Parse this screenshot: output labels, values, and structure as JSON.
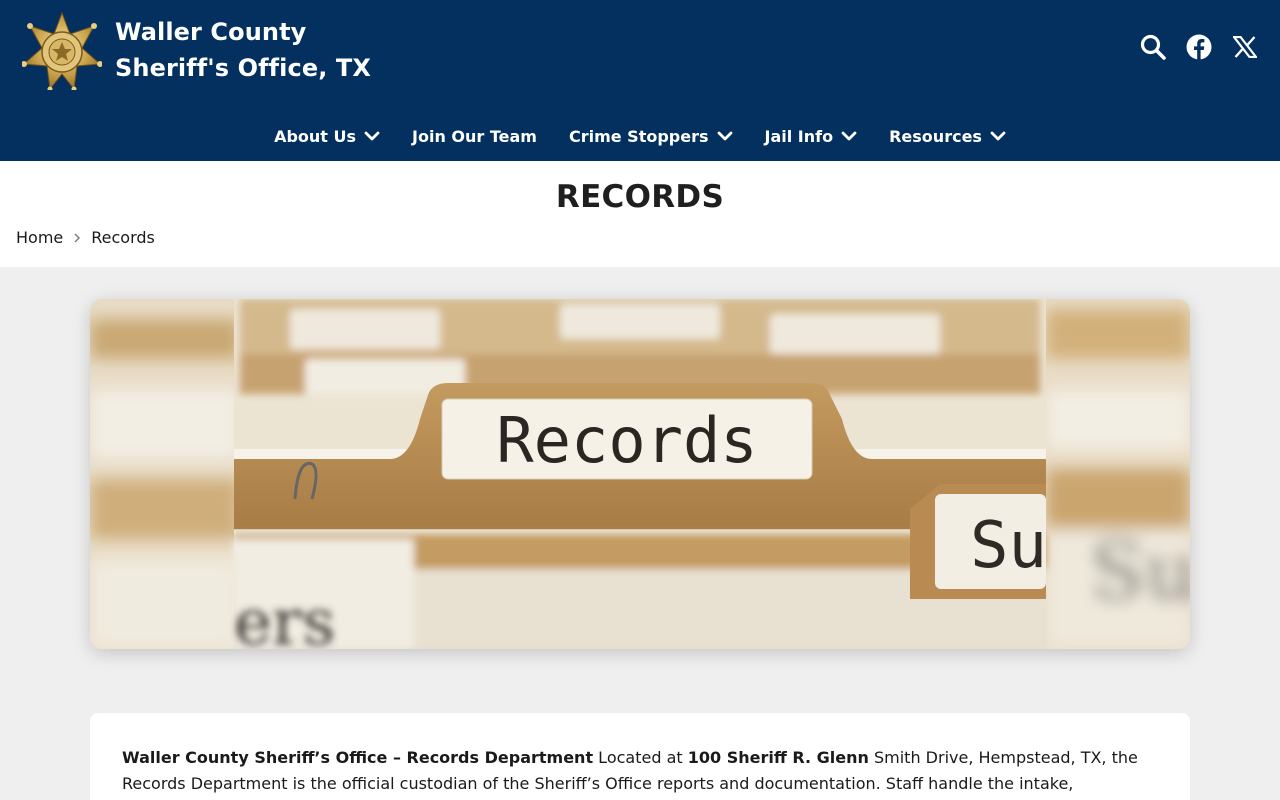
{
  "site": {
    "name_line1": "Waller County",
    "name_line2": "Sheriff's Office, TX",
    "badge_icon": "sheriff-star-badge-icon"
  },
  "header_icons": [
    {
      "name": "search-icon"
    },
    {
      "name": "facebook-icon"
    },
    {
      "name": "x-twitter-icon"
    }
  ],
  "nav": {
    "items": [
      {
        "label": "About Us",
        "has_dropdown": true
      },
      {
        "label": "Join Our Team",
        "has_dropdown": false
      },
      {
        "label": "Crime Stoppers",
        "has_dropdown": true
      },
      {
        "label": "Jail Info",
        "has_dropdown": true
      },
      {
        "label": "Resources",
        "has_dropdown": true
      }
    ]
  },
  "page": {
    "title": "RECORDS",
    "breadcrumb": {
      "home": "Home",
      "current": "Records"
    }
  },
  "hero": {
    "tab_text": "Records",
    "tab_text_right": "Su",
    "tab_text_bottom_left": "ers"
  },
  "content": {
    "intro_bold": "Waller County Sheriff’s Office – Records Department",
    "intro_text1": " Located at ",
    "address_bold": "100 Sheriff R. Glenn",
    "intro_text2": " Smith Drive, Hempstead, TX, the Records Department is the official custodian of the Sheriff’s Office reports and documentation. Staff handle the intake,"
  },
  "colors": {
    "header_bg": "#03305e",
    "page_bg": "#efefef",
    "white": "#ffffff"
  }
}
